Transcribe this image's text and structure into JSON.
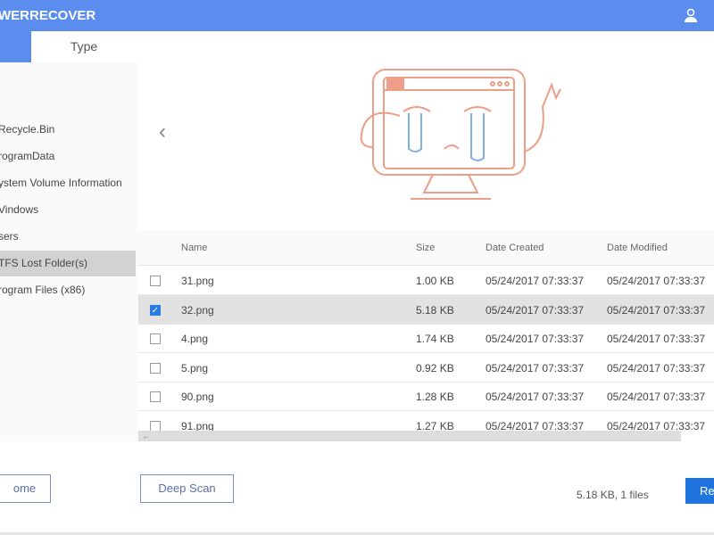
{
  "header": {
    "brand": "WERRECOVER"
  },
  "tabs": [
    {
      "label": ""
    },
    {
      "label": "Type"
    }
  ],
  "sidebar": {
    "items": [
      {
        "label": "Recycle.Bin"
      },
      {
        "label": "rogramData"
      },
      {
        "label": "ystem Volume Information"
      },
      {
        "label": "Vindows"
      },
      {
        "label": "sers"
      },
      {
        "label": "TFS Lost Folder(s)",
        "selected": true
      },
      {
        "label": "rogram Files (x86)"
      }
    ]
  },
  "table": {
    "columns": [
      "Name",
      "Size",
      "Date Created",
      "Date Modified"
    ],
    "rows": [
      {
        "name": "31.png",
        "size": "1.00 KB",
        "created": "05/24/2017 07:33:37",
        "modified": "05/24/2017 07:33:37",
        "checked": false
      },
      {
        "name": "32.png",
        "size": "5.18 KB",
        "created": "05/24/2017 07:33:37",
        "modified": "05/24/2017 07:33:37",
        "checked": true
      },
      {
        "name": "4.png",
        "size": "1.74 KB",
        "created": "05/24/2017 07:33:37",
        "modified": "05/24/2017 07:33:37",
        "checked": false
      },
      {
        "name": "5.png",
        "size": "0.92 KB",
        "created": "05/24/2017 07:33:37",
        "modified": "05/24/2017 07:33:37",
        "checked": false
      },
      {
        "name": "90.png",
        "size": "1.28 KB",
        "created": "05/24/2017 07:33:37",
        "modified": "05/24/2017 07:33:37",
        "checked": false
      },
      {
        "name": "91.png",
        "size": "1.27 KB",
        "created": "05/24/2017 07:33:37",
        "modified": "05/24/2017 07:33:37",
        "checked": false
      }
    ]
  },
  "footer": {
    "home_label": "ome",
    "deep_scan_label": "Deep Scan",
    "status": "5.18 KB, 1 files",
    "recover_label": "Re"
  },
  "colors": {
    "accent": "#5a8ded",
    "primary_button": "#1f74de"
  }
}
